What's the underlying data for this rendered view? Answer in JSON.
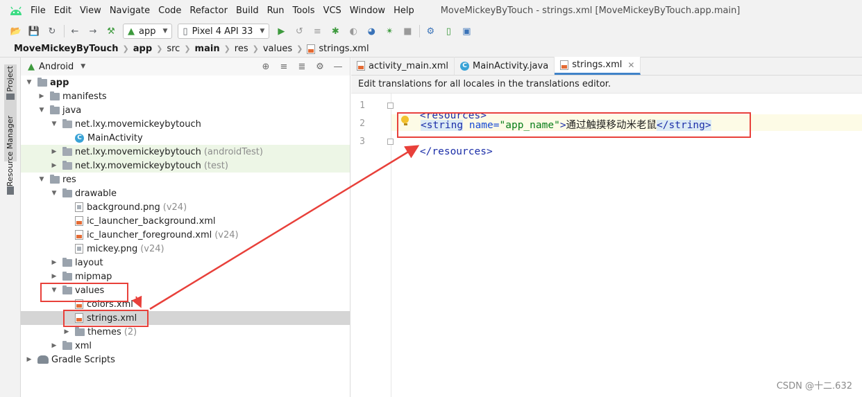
{
  "menubar": {
    "items": [
      "File",
      "Edit",
      "View",
      "Navigate",
      "Code",
      "Refactor",
      "Build",
      "Run",
      "Tools",
      "VCS",
      "Window",
      "Help"
    ],
    "window_title": "MoveMickeyByTouch - strings.xml [MoveMickeyByTouch.app.main]"
  },
  "toolbar": {
    "module": "app",
    "device": "Pixel 4 API 33"
  },
  "breadcrumb": [
    "MoveMickeyByTouch",
    "app",
    "src",
    "main",
    "res",
    "values",
    "strings.xml"
  ],
  "side_strip": {
    "project_tab": "Project",
    "resource_manager_tab": "Resource Manager"
  },
  "project_panel": {
    "view_mode": "Android",
    "tree": [
      {
        "label": "app",
        "suffix": ""
      },
      {
        "label": "manifests",
        "suffix": ""
      },
      {
        "label": "java",
        "suffix": ""
      },
      {
        "label": "net.lxy.movemickeybytouch",
        "suffix": ""
      },
      {
        "label": "MainActivity",
        "suffix": ""
      },
      {
        "label": "net.lxy.movemickeybytouch",
        "suffix": "(androidTest)"
      },
      {
        "label": "net.lxy.movemickeybytouch",
        "suffix": "(test)"
      },
      {
        "label": "res",
        "suffix": ""
      },
      {
        "label": "drawable",
        "suffix": ""
      },
      {
        "label": "background.png",
        "suffix": "(v24)"
      },
      {
        "label": "ic_launcher_background.xml",
        "suffix": ""
      },
      {
        "label": "ic_launcher_foreground.xml",
        "suffix": "(v24)"
      },
      {
        "label": "mickey.png",
        "suffix": "(v24)"
      },
      {
        "label": "layout",
        "suffix": ""
      },
      {
        "label": "mipmap",
        "suffix": ""
      },
      {
        "label": "values",
        "suffix": ""
      },
      {
        "label": "colors.xml",
        "suffix": ""
      },
      {
        "label": "strings.xml",
        "suffix": ""
      },
      {
        "label": "themes",
        "suffix": "(2)"
      },
      {
        "label": "xml",
        "suffix": ""
      },
      {
        "label": "Gradle Scripts",
        "suffix": ""
      }
    ]
  },
  "editor": {
    "tabs": [
      {
        "label": "activity_main.xml"
      },
      {
        "label": "MainActivity.java"
      },
      {
        "label": "strings.xml"
      }
    ],
    "notice": "Edit translations for all locales in the translations editor.",
    "line_numbers": [
      "1",
      "2",
      "3"
    ],
    "code": {
      "l1_open": "<resources>",
      "l2_tag_open": "<string",
      "l2_attr": " name=",
      "l2_value": "\"app_name\"",
      "l2_close_bracket": ">",
      "l2_text": "通过触摸移动米老鼠",
      "l2_tag_close": "</string>",
      "l3_close": "</resources>"
    }
  },
  "watermark": "CSDN @十二.632",
  "colors": {
    "annotation": "#e8403a",
    "selection": "#d5d5d5",
    "test_bg": "#edf6e6",
    "active_tab": "#4083c9"
  }
}
